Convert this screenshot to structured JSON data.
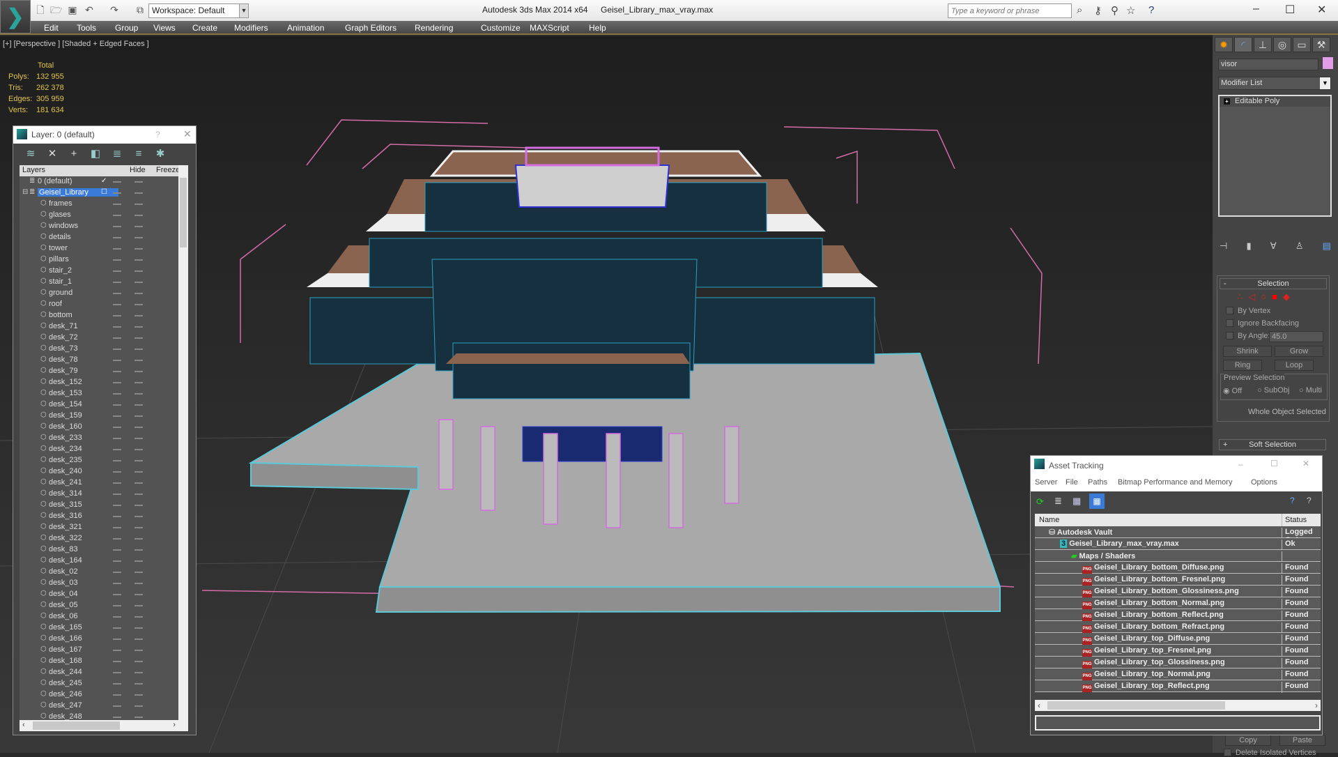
{
  "app": {
    "title": "Autodesk 3ds Max  2014 x64",
    "file": "Geisel_Library_max_vray.max",
    "workspace": "Workspace: Default",
    "search_placeholder": "Type a keyword or phrase"
  },
  "menu": [
    "Edit",
    "Tools",
    "Group",
    "Views",
    "Create",
    "Modifiers",
    "Animation",
    "Graph Editors",
    "Rendering",
    "Customize",
    "MAXScript",
    "Help"
  ],
  "viewport": {
    "label": "[+] [Perspective ] [Shaded + Edged Faces ]",
    "stats": {
      "header": "Total",
      "rows": [
        {
          "k": "Polys:",
          "v": "132 955"
        },
        {
          "k": "Tris:",
          "v": "262 378"
        },
        {
          "k": "Edges:",
          "v": "305 959"
        },
        {
          "k": "Verts:",
          "v": "181 634"
        }
      ]
    }
  },
  "layer_panel": {
    "title": "Layer: 0 (default)",
    "help": "?",
    "col_layers": "Layers",
    "col_hide": "Hide",
    "col_freeze": "Freeze",
    "layers": [
      {
        "name": "0 (default)",
        "level": 0,
        "current": true
      },
      {
        "name": "Geisel_Library",
        "level": 0,
        "selected": true
      },
      {
        "name": "frames"
      },
      {
        "name": "glases"
      },
      {
        "name": "windows"
      },
      {
        "name": "details"
      },
      {
        "name": "tower"
      },
      {
        "name": "pillars"
      },
      {
        "name": "stair_2"
      },
      {
        "name": "stair_1"
      },
      {
        "name": "ground"
      },
      {
        "name": "roof"
      },
      {
        "name": "bottom"
      },
      {
        "name": "desk_71"
      },
      {
        "name": "desk_72"
      },
      {
        "name": "desk_73"
      },
      {
        "name": "desk_78"
      },
      {
        "name": "desk_79"
      },
      {
        "name": "desk_152"
      },
      {
        "name": "desk_153"
      },
      {
        "name": "desk_154"
      },
      {
        "name": "desk_159"
      },
      {
        "name": "desk_160"
      },
      {
        "name": "desk_233"
      },
      {
        "name": "desk_234"
      },
      {
        "name": "desk_235"
      },
      {
        "name": "desk_240"
      },
      {
        "name": "desk_241"
      },
      {
        "name": "desk_314"
      },
      {
        "name": "desk_315"
      },
      {
        "name": "desk_316"
      },
      {
        "name": "desk_321"
      },
      {
        "name": "desk_322"
      },
      {
        "name": "desk_83"
      },
      {
        "name": "desk_164"
      },
      {
        "name": "desk_02"
      },
      {
        "name": "desk_03"
      },
      {
        "name": "desk_04"
      },
      {
        "name": "desk_05"
      },
      {
        "name": "desk_06"
      },
      {
        "name": "desk_165"
      },
      {
        "name": "desk_166"
      },
      {
        "name": "desk_167"
      },
      {
        "name": "desk_168"
      },
      {
        "name": "desk_244"
      },
      {
        "name": "desk_245"
      },
      {
        "name": "desk_246"
      },
      {
        "name": "desk_247"
      },
      {
        "name": "desk_248"
      }
    ]
  },
  "command_panel": {
    "object_name": "visor",
    "object_color": "#e19ee6",
    "modifier_list": "Modifier List",
    "stack": [
      "Editable Poly"
    ],
    "selection": {
      "title": "Selection",
      "by_vertex": "By Vertex",
      "ignore_backfacing": "Ignore Backfacing",
      "by_angle": "By Angle:",
      "angle_value": "45.0",
      "shrink": "Shrink",
      "grow": "Grow",
      "ring": "Ring",
      "loop": "Loop",
      "preview_selection": "Preview Selection",
      "off": "Off",
      "subobj": "SubObj",
      "multi": "Multi",
      "status": "Whole Object Selected"
    },
    "soft_selection": "Soft Selection",
    "copy": "Copy",
    "paste": "Paste",
    "delete_isolated": "Delete Isolated Vertices"
  },
  "asset_tracking": {
    "title": "Asset Tracking",
    "menu": [
      "Server",
      "File",
      "Paths",
      "Bitmap Performance and Memory",
      "Options"
    ],
    "col_name": "Name",
    "col_status": "Status",
    "rows": [
      {
        "name": "Autodesk Vault",
        "status": "Logged Out",
        "level": 0,
        "icon": "vault"
      },
      {
        "name": "Geisel_Library_max_vray.max",
        "status": "Ok",
        "level": 1,
        "icon": "max"
      },
      {
        "name": "Maps / Shaders",
        "status": "",
        "level": 2,
        "icon": "maps"
      },
      {
        "name": "Geisel_Library_bottom_Diffuse.png",
        "status": "Found",
        "level": 3,
        "icon": "png"
      },
      {
        "name": "Geisel_Library_bottom_Fresnel.png",
        "status": "Found",
        "level": 3,
        "icon": "png"
      },
      {
        "name": "Geisel_Library_bottom_Glossiness.png",
        "status": "Found",
        "level": 3,
        "icon": "png"
      },
      {
        "name": "Geisel_Library_bottom_Normal.png",
        "status": "Found",
        "level": 3,
        "icon": "png"
      },
      {
        "name": "Geisel_Library_bottom_Reflect.png",
        "status": "Found",
        "level": 3,
        "icon": "png"
      },
      {
        "name": "Geisel_Library_bottom_Refract.png",
        "status": "Found",
        "level": 3,
        "icon": "png"
      },
      {
        "name": "Geisel_Library_top_Diffuse.png",
        "status": "Found",
        "level": 3,
        "icon": "png"
      },
      {
        "name": "Geisel_Library_top_Fresnel.png",
        "status": "Found",
        "level": 3,
        "icon": "png"
      },
      {
        "name": "Geisel_Library_top_Glossiness.png",
        "status": "Found",
        "level": 3,
        "icon": "png"
      },
      {
        "name": "Geisel_Library_top_Normal.png",
        "status": "Found",
        "level": 3,
        "icon": "png"
      },
      {
        "name": "Geisel_Library_top_Reflect.png",
        "status": "Found",
        "level": 3,
        "icon": "png"
      }
    ]
  }
}
